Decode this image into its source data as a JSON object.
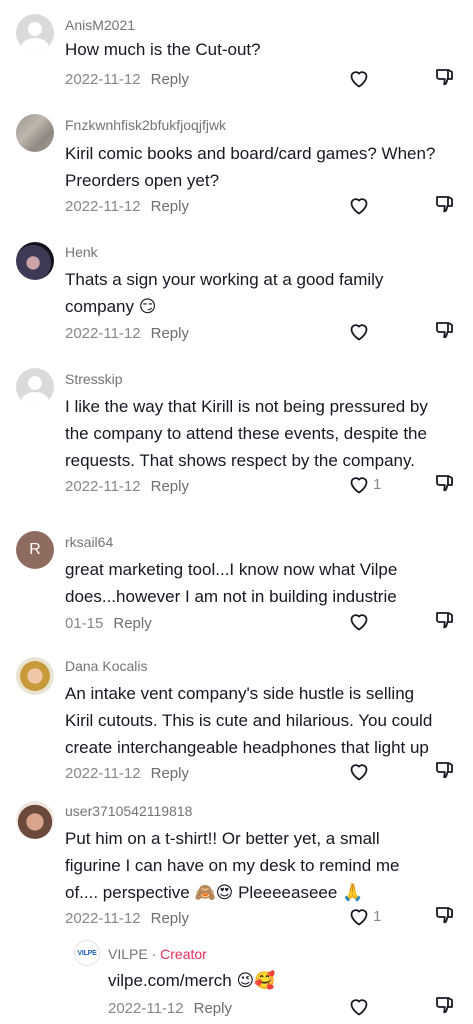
{
  "comments": [
    {
      "username": "AnisM2021",
      "avatar": "default-avatar",
      "lines": [
        "How much is the Cut-out?"
      ],
      "date": "2022-11-12",
      "reply": "Reply",
      "likes": ""
    },
    {
      "username": "Fnzkwnhfisk2bfukfjoqjfjwk",
      "avatar": "texture-avatar",
      "lines": [
        "Kiril comic books and board/card games? When?",
        "Preorders open yet?"
      ],
      "date": "2022-11-12",
      "reply": "Reply",
      "likes": ""
    },
    {
      "username": "Henk",
      "avatar": "photo-avatar",
      "lines": [
        "Thats a sign your working at a good family",
        "company 😏"
      ],
      "date": "2022-11-12",
      "reply": "Reply",
      "likes": ""
    },
    {
      "username": "Stresskip",
      "avatar": "default-avatar",
      "lines": [
        "I like the way that Kirill is not being pressured by",
        "the company to attend these events, despite the",
        "requests. That shows respect by the company."
      ],
      "date": "2022-11-12",
      "reply": "Reply",
      "likes": "1"
    },
    {
      "username": "rksail64",
      "avatar": "R",
      "lines": [
        "great marketing tool...I know now what Vilpe",
        "does...however I am not in building industrie"
      ],
      "date": "01-15",
      "reply": "Reply",
      "likes": ""
    },
    {
      "username": "Dana Kocalis",
      "avatar": "photo-avatar",
      "lines": [
        "An intake vent company's side hustle is selling",
        "Kiril cutouts. This is cute and hilarious. You could",
        "create interchangeable headphones that light up"
      ],
      "date": "2022-11-12",
      "reply": "Reply",
      "likes": ""
    },
    {
      "username": "user3710542119818",
      "avatar": "photo-avatar",
      "lines": [
        "Put him on a t-shirt!! Or better yet, a small",
        "figurine I can have on my desk to remind me",
        "of.... perspective 🙈😍 Pleeeeaseee 🙏"
      ],
      "date": "2022-11-12",
      "reply": "Reply",
      "likes": "1"
    }
  ],
  "creator_reply": {
    "username": "VILPE",
    "separator": " · ",
    "creator_label": "Creator",
    "avatar_text": "VILPE",
    "lines": [
      "vilpe.com/merch 😉🥰"
    ],
    "date": "2022-11-12",
    "reply": "Reply",
    "likes": ""
  },
  "icons": {
    "like": "heart-outline-icon",
    "dislike": "thumbs-down-outline-icon"
  },
  "colors": {
    "creator": "#ee2d5a",
    "text": "#161823",
    "meta": "#86878b"
  }
}
